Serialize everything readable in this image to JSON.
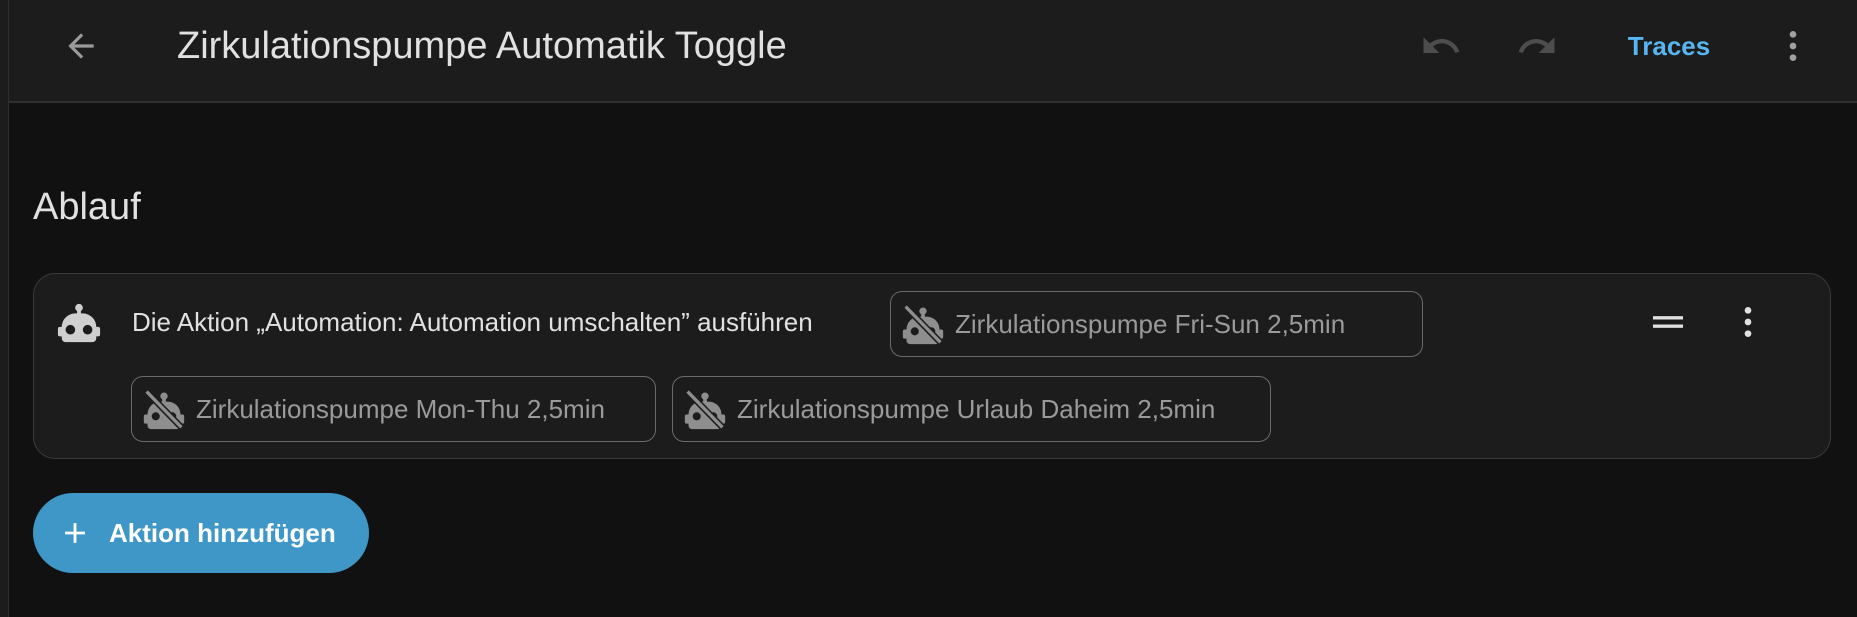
{
  "header": {
    "title": "Zirkulationspumpe Automatik Toggle",
    "traces_label": "Traces",
    "icons": {
      "back": "arrow-left-icon",
      "undo": "undo-icon",
      "redo": "redo-icon",
      "more": "dots-vertical-icon"
    }
  },
  "section": {
    "title": "Ablauf"
  },
  "action": {
    "description": "Die Aktion „Automation: Automation umschalten” ausführen",
    "targets": [
      {
        "label": "Zirkulationspumpe Fri-Sun 2,5min",
        "icon": "robot-off-icon"
      },
      {
        "label": "Zirkulationspumpe Mon-Thu 2,5min",
        "icon": "robot-off-icon"
      },
      {
        "label": "Zirkulationspumpe Urlaub Daheim 2,5min",
        "icon": "robot-off-icon"
      }
    ]
  },
  "add_action": {
    "label": "Aktion hinzufügen"
  },
  "colors": {
    "background": "#111111",
    "surface": "#1c1c1c",
    "accent": "#58b5f0",
    "primary_button": "#3f97c8",
    "text": "#e1e1e1",
    "muted": "#9a9a9a"
  }
}
